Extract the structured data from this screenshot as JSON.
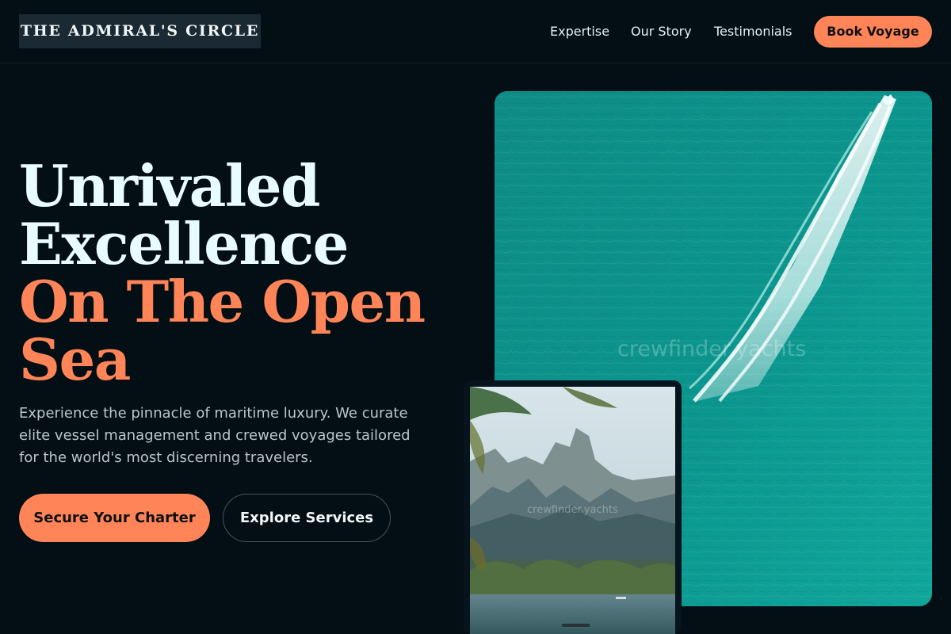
{
  "brand": {
    "name": "THE ADMIRAL'S CIRCLE"
  },
  "navigation": {
    "links": [
      "Expertise",
      "Our Story",
      "Testimonials"
    ],
    "cta": "Book Voyage"
  },
  "hero": {
    "title_lines": [
      "Unrivaled",
      "Excellence"
    ],
    "accent_lines": [
      "On The Open",
      "Sea"
    ],
    "description": "Experience the pinnacle of maritime luxury. We curate elite vessel management and crewed voyages tailored for the world's most discerning travelers.",
    "primary_cta": "Secure Your Charter",
    "secondary_cta": "Explore Services"
  },
  "images": {
    "ocean_watermark": "crewfinder.yachts",
    "mountain_watermark": "crewfinder.yachts"
  },
  "colors": {
    "background": "#030e15",
    "accent": "#ff8558",
    "heading": "#e8fbff",
    "ocean": "#0d8b83"
  }
}
